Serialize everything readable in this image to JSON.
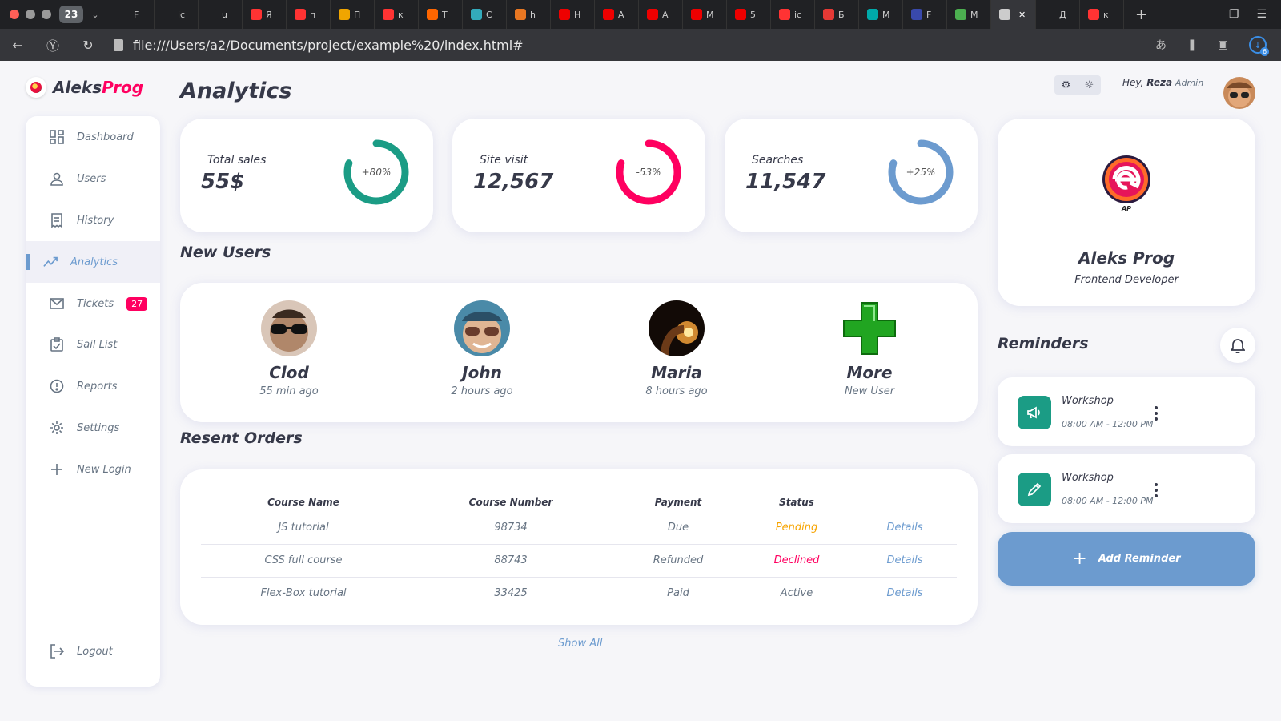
{
  "browser": {
    "tab_count": "23",
    "tabs": [
      {
        "icon": "github-icon",
        "letter": "F",
        "color": "#202124"
      },
      {
        "icon": "page-icon",
        "letter": "ic",
        "color": "#202124"
      },
      {
        "icon": "page-icon",
        "letter": "u",
        "color": "#202124"
      },
      {
        "icon": "yandex-icon",
        "letter": "Я",
        "color": "#f33"
      },
      {
        "icon": "yandex-icon",
        "letter": "п",
        "color": "#f33"
      },
      {
        "icon": "image-icon",
        "letter": "П",
        "color": "#f0a500"
      },
      {
        "icon": "yandex-icon",
        "letter": "к",
        "color": "#f33"
      },
      {
        "icon": "sp-icon",
        "letter": "T",
        "color": "#f60"
      },
      {
        "icon": "star-icon",
        "letter": "C",
        "color": "#3ab"
      },
      {
        "icon": "stack-icon",
        "letter": "h",
        "color": "#e87722"
      },
      {
        "icon": "youtube-icon",
        "letter": "H",
        "color": "#e00"
      },
      {
        "icon": "youtube-icon",
        "letter": "A",
        "color": "#e00"
      },
      {
        "icon": "youtube-icon",
        "letter": "A",
        "color": "#e00"
      },
      {
        "icon": "youtube-icon",
        "letter": "M",
        "color": "#e00"
      },
      {
        "icon": "youtube-icon",
        "letter": "5",
        "color": "#e00"
      },
      {
        "icon": "yandex-icon",
        "letter": "ic",
        "color": "#f33"
      },
      {
        "icon": "l-icon",
        "letter": "Б",
        "color": "#e53935"
      },
      {
        "icon": "flo-icon",
        "letter": "M",
        "color": "#0aa"
      },
      {
        "icon": "l-icon",
        "letter": "F",
        "color": "#3949ab"
      },
      {
        "icon": "m-icon",
        "letter": "M",
        "color": "#4caf50"
      },
      {
        "icon": "file-icon",
        "letter": "",
        "color": "#ccc",
        "active": true
      },
      {
        "icon": "sparkle-icon",
        "letter": "Д",
        "color": "#202124"
      },
      {
        "icon": "yandex-icon",
        "letter": "к",
        "color": "#f33"
      }
    ],
    "url": "file:///Users/a2/Documents/project/example%20/index.html#",
    "download_badge": "6"
  },
  "logo": {
    "part1": "Aleks",
    "part2": "Prog"
  },
  "sidebar": {
    "items": [
      {
        "label": "Dashboard",
        "icon": "dashboard-icon"
      },
      {
        "label": "Users",
        "icon": "user-icon"
      },
      {
        "label": "History",
        "icon": "receipt-icon"
      },
      {
        "label": "Analytics",
        "icon": "analytics-icon",
        "active": true
      },
      {
        "label": "Tickets",
        "icon": "mail-icon",
        "badge": "27"
      },
      {
        "label": "Sail List",
        "icon": "clipboard-icon"
      },
      {
        "label": "Reports",
        "icon": "report-icon"
      },
      {
        "label": "Settings",
        "icon": "gear-icon"
      },
      {
        "label": "New Login",
        "icon": "plus-icon"
      }
    ],
    "logout": "Logout"
  },
  "page_title": "Analytics",
  "stats": [
    {
      "label": "Total sales",
      "value": "55$",
      "percent": "+80%",
      "fill": 0.8,
      "color": "#1b9c85"
    },
    {
      "label": "Site visit",
      "value": "12,567",
      "percent": "-53%",
      "fill": 0.8,
      "color": "#ff0060"
    },
    {
      "label": "Searches",
      "value": "11,547",
      "percent": "+25%",
      "fill": 0.8,
      "color": "#6c9bcf"
    }
  ],
  "new_users": {
    "title": "New Users",
    "users": [
      {
        "name": "Clod",
        "time": "55 min ago"
      },
      {
        "name": "John",
        "time": "2 hours ago"
      },
      {
        "name": "Maria",
        "time": "8 hours ago"
      },
      {
        "name": "More",
        "time": "New User"
      }
    ]
  },
  "orders": {
    "title": "Resent Orders",
    "headers": [
      "Course Name",
      "Course Number",
      "Payment",
      "Status",
      ""
    ],
    "rows": [
      {
        "name": "JS tutorial",
        "number": "98734",
        "payment": "Due",
        "status": "Pending",
        "details": "Details"
      },
      {
        "name": "CSS full course",
        "number": "88743",
        "payment": "Refunded",
        "status": "Declined",
        "details": "Details"
      },
      {
        "name": "Flex-Box tutorial",
        "number": "33425",
        "payment": "Paid",
        "status": "Active",
        "details": "Details"
      }
    ],
    "show_all": "Show All"
  },
  "header": {
    "greeting": "Hey,",
    "user": "Reza",
    "role": "Admin"
  },
  "profile": {
    "name": "Aleks Prog",
    "role": "Frontend Developer",
    "logo_caption": "AP"
  },
  "reminders": {
    "title": "Reminders",
    "items": [
      {
        "title": "Workshop",
        "time": "08:00 AM - 12:00 PM",
        "icon": "megaphone-icon"
      },
      {
        "title": "Workshop",
        "time": "08:00 AM - 12:00 PM",
        "icon": "pencil-icon"
      }
    ],
    "add_label": "Add Reminder"
  }
}
